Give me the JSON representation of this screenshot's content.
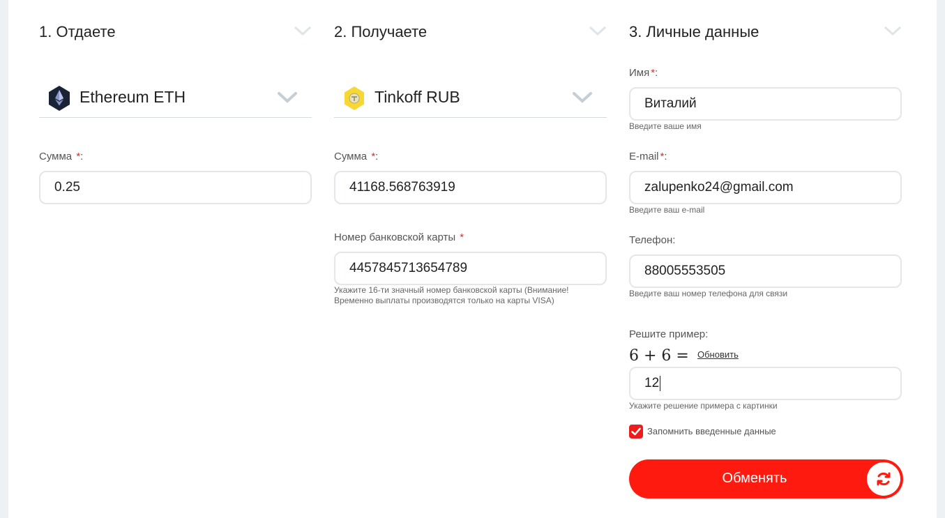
{
  "give": {
    "title": "1. Отдаете",
    "currency": "Ethereum ETH",
    "amount_label": "Сумма",
    "amount_value": "0.25"
  },
  "receive": {
    "title": "2. Получаете",
    "currency": "Tinkoff RUB",
    "amount_label": "Сумма",
    "amount_value": "41168.568763919",
    "card_label": "Номер банковской карты",
    "card_value": "4457845713654789",
    "card_hint_line1": "Укажите 16-ти значный номер банковской карты (Внимание!",
    "card_hint_line2": "Временно выплаты производятся только на карты VISA)"
  },
  "personal": {
    "title": "3. Личные данные",
    "name_label": "Имя",
    "name_value": "Виталий",
    "name_hint": "Введите ваше имя",
    "email_label": "E-mail",
    "email_value": "zalupenko24@gmail.com",
    "email_hint": "Введите ваш e-mail",
    "phone_label": "Телефон:",
    "phone_value": "88005553505",
    "phone_hint": "Введите ваш номер телефона для связи",
    "captcha_label": "Решите пример:",
    "captcha_expression": "6 + 6 =",
    "captcha_refresh": "Обновить",
    "captcha_value": "12",
    "captcha_hint": "Укажите решение примера с картинки",
    "remember_label": "Запомнить введенные данные",
    "remember_checked": true,
    "submit_label": "Обменять"
  },
  "required_mark": "*",
  "label_colon": ":",
  "icons": {
    "step_chevron": "chevron-down-icon",
    "eth": "ethereum-icon",
    "tinkoff": "tinkoff-icon",
    "checkbox": "check-icon",
    "submit": "refresh-icon"
  },
  "colors": {
    "accent": "#ff1a10",
    "required": "#e42a23",
    "input_border": "#e4e6e9",
    "chevron": "#c5ced6"
  }
}
